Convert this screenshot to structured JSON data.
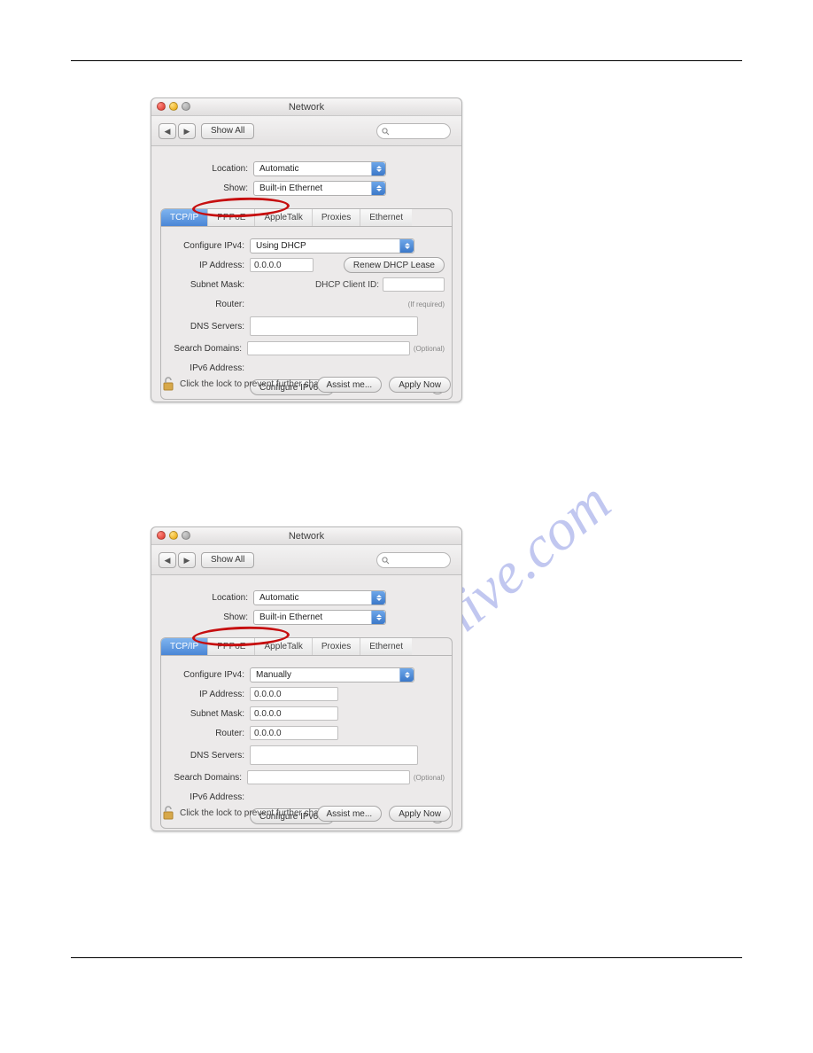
{
  "panel": {
    "title": "Network",
    "showAll": "Show All",
    "locationLabel": "Location:",
    "location": "Automatic",
    "showLabel": "Show:",
    "show": "Built-in Ethernet",
    "tabs": [
      "TCP/IP",
      "PPPoE",
      "AppleTalk",
      "Proxies",
      "Ethernet"
    ],
    "configLabel": "Configure IPv4:",
    "ipLabel": "IP Address:",
    "subnetLabel": "Subnet Mask:",
    "routerLabel": "Router:",
    "dnsLabel": "DNS Servers:",
    "searchLabel": "Search Domains:",
    "ipv6Label": "IPv6 Address:",
    "configIPv6": "Configure IPv6...",
    "optional": "(Optional)",
    "lockText": "Click the lock to prevent further changes.",
    "assist": "Assist me...",
    "apply": "Apply Now"
  },
  "panel1": {
    "configValue": "Using DHCP",
    "ip": "0.0.0.0",
    "renew": "Renew DHCP Lease",
    "dhcpClientLabel": "DHCP Client ID:",
    "dhcpHint": "(If required)"
  },
  "panel2": {
    "configValue": "Manually",
    "ip": "0.0.0.0",
    "subnet": "0.0.0.0",
    "router": "0.0.0.0"
  },
  "watermark": "manualshive.com"
}
